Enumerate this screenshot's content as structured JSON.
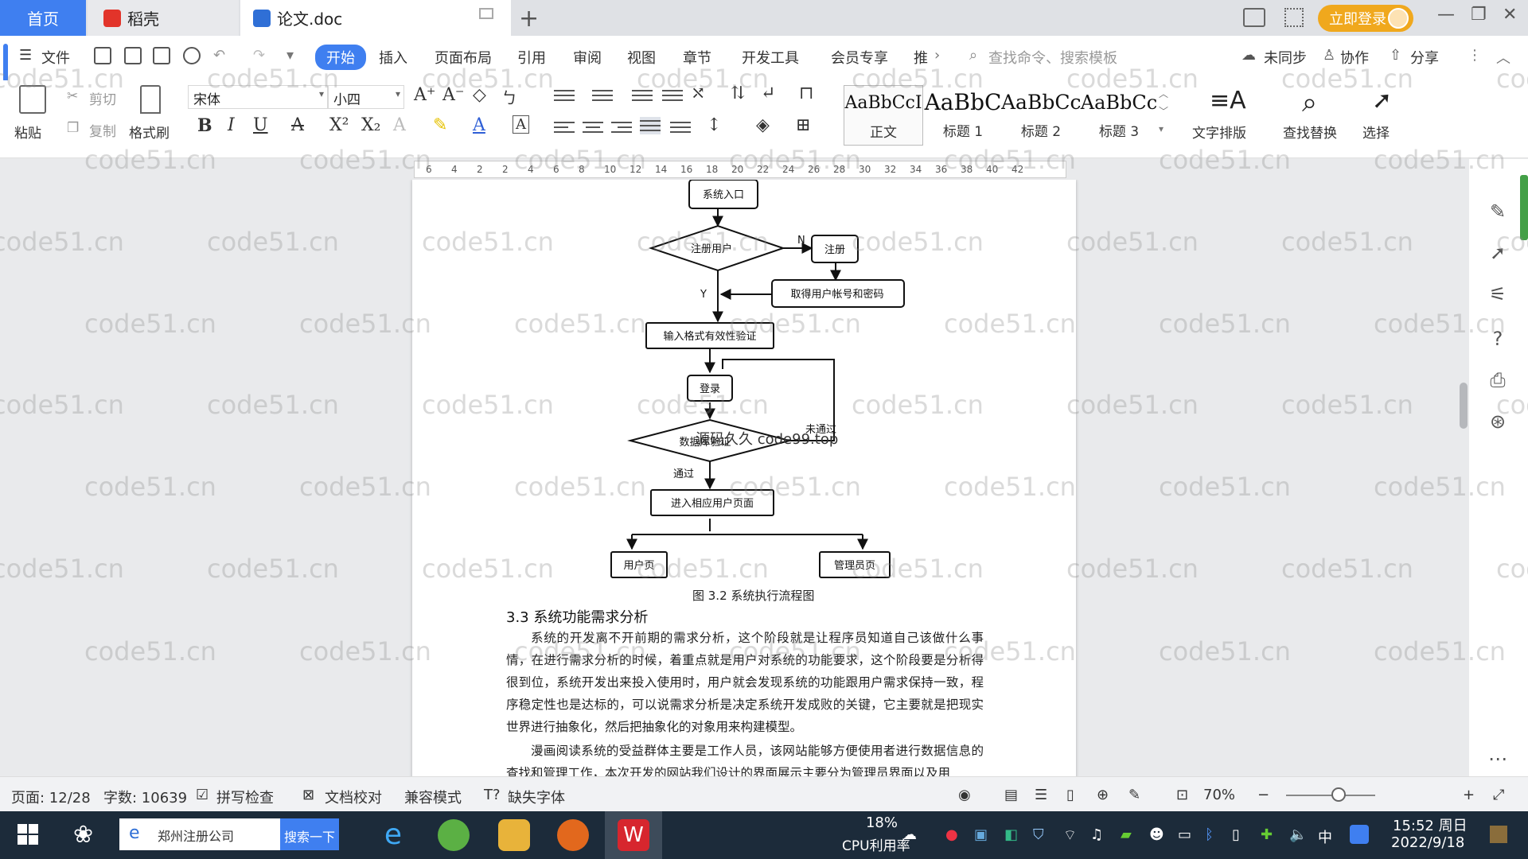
{
  "tabs": {
    "home": "首页",
    "docer": "稻壳",
    "doc": "论文.doc",
    "new_tab": "+"
  },
  "header": {
    "login": "立即登录"
  },
  "menu": {
    "file": "文件",
    "items": [
      "开始",
      "插入",
      "页面布局",
      "引用",
      "审阅",
      "视图",
      "章节",
      "开发工具",
      "会员专享",
      "推"
    ],
    "search": "查找命令、搜索模板",
    "sync": "未同步",
    "collab": "协作",
    "share": "分享"
  },
  "ribbon": {
    "paste": "粘贴",
    "cut": "剪切",
    "copy": "复制",
    "format_painter": "格式刷",
    "font_name": "宋体",
    "font_size": "小四",
    "styles": [
      {
        "preview": "AaBbCcI",
        "name": "正文"
      },
      {
        "preview": "AaBbC",
        "name": "标题 1"
      },
      {
        "preview": "AaBbCc",
        "name": "标题 2"
      },
      {
        "preview": "AaBbCc",
        "name": "标题 3"
      }
    ],
    "text_layout": "文字排版",
    "find_replace": "查找替换",
    "select": "选择"
  },
  "ruler": {
    "marks": [
      "6",
      "4",
      "2",
      "2",
      "4",
      "6",
      "8",
      "10",
      "12",
      "14",
      "16",
      "18",
      "20",
      "22",
      "24",
      "26",
      "28",
      "30",
      "32",
      "34",
      "36",
      "38",
      "40",
      "42"
    ]
  },
  "document": {
    "flowchart": {
      "entry": "系统入口",
      "register_check": "注册用户",
      "branch_n": "N",
      "register": "注册",
      "get_account": "取得用户帐号和密码",
      "branch_y": "Y",
      "validate": "输入格式有效性验证",
      "login": "登录",
      "db_check": "数据库验证",
      "pass": "通过",
      "fail": "未通过",
      "enter_page": "进入相应用户页面",
      "user_page": "用户页",
      "admin_page": "管理员页"
    },
    "caption": "图 3.2  系统执行流程图",
    "section_heading": "3.3 系统功能需求分析",
    "para1": "系统的开发离不开前期的需求分析，这个阶段就是让程序员知道自己该做什么事情，在进行需求分析的时候，着重点就是用户对系统的功能要求，这个阶段要是分析得很到位，系统开发出来投入使用时，用户就会发现系统的功能跟用户需求保持一致，程序稳定性也是达标的，可以说需求分析是决定系统开发成败的关键，它主要就是把现实世界进行抽象化，然后把抽象化的对象用来构建模型。",
    "para2": "漫画阅读系统的受益群体主要是工作人员，该网站能够方便使用者进行数据信息的查找和管理工作，本次开发的网站我们设计的界面展示主要分为管理员界面以及用",
    "overlay_text": "源码久久 code99.top"
  },
  "watermark": "code51.cn",
  "status": {
    "page": "页面: 12/28",
    "words": "字数: 10639",
    "spell": "拼写检查",
    "proof": "文档校对",
    "compat": "兼容模式",
    "missing_font": "缺失字体",
    "zoom": "70%"
  },
  "taskbar": {
    "search_text": "郑州注册公司",
    "search_btn": "搜索一下",
    "cpu_pct": "18%",
    "cpu_label": "CPU利用率",
    "ime": "中",
    "time": "15:52 周日",
    "date": "2022/9/18"
  },
  "colors": {
    "accent": "#3f7ff0",
    "login_orange": "#f0a81d",
    "taskbar": "#1c2b3a"
  }
}
